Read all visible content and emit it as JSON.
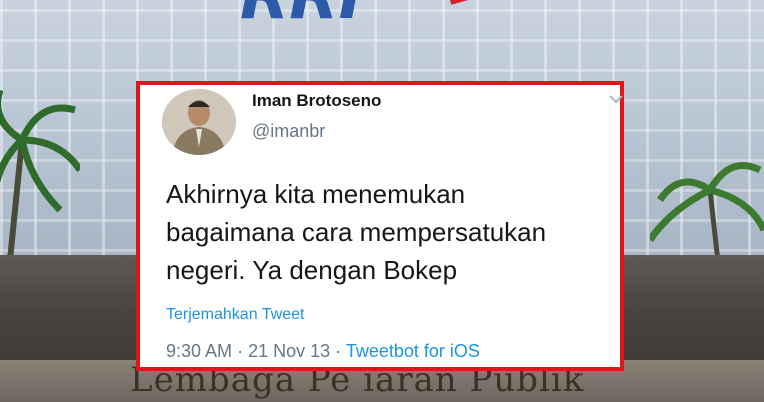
{
  "background": {
    "sign_text": "Lembaga Pe  iaran  Publik",
    "logo_text": "RRI"
  },
  "tweet": {
    "display_name": "Iman Brotoseno",
    "handle": "@imanbr",
    "text_line1": "Akhirnya kita menemukan",
    "text_line2": "bagaimana cara mempersatukan",
    "text_line3": "negeri. Ya dengan Bokep",
    "translate_label": "Terjemahkan Tweet",
    "time": "9:30 AM",
    "date": "21 Nov 13",
    "separator": "·",
    "source": "Tweetbot for iOS",
    "highlight_color": "#e2141c",
    "link_color": "#1b95e0"
  }
}
